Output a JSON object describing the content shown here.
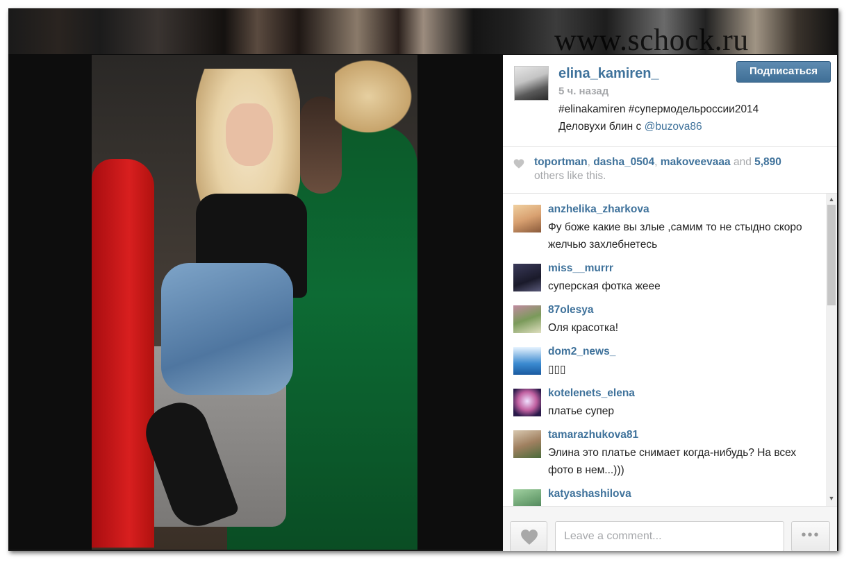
{
  "background": {
    "watermark": "www.schock.ru"
  },
  "post": {
    "username": "elina_kamiren_",
    "time": "5 ч. назад",
    "follow_label": "Подписаться",
    "caption_line1": "#elinakamiren #супермодельроссии2014 ",
    "caption_line2_prefix": "Деловухи блин с ",
    "caption_mention": "@buzova86"
  },
  "likes": {
    "user1": "toportman",
    "sep1": ", ",
    "user2": "dasha_0504",
    "sep2": ", ",
    "user3": "makoveevaaa",
    "and": " and ",
    "count": "5,890",
    "suffix": "others like this."
  },
  "comments": [
    {
      "user": "anzhelika_zharkova",
      "text": "Фу боже какие вы злые ,самим то не стыдно скоро желчью захлебнетесь",
      "avatar_color": "#d8a070"
    },
    {
      "user": "miss__murrr",
      "text": "суперская фотка жеее",
      "avatar_color": "#2a2a3a"
    },
    {
      "user": "87olesya",
      "text": "Оля красотка!",
      "avatar_color": "#7a9a5a"
    },
    {
      "user": "dom2_news_",
      "text": "",
      "avatar_color": "#3a8ad0"
    },
    {
      "user": "kotelenets_elena",
      "text": "платье супер",
      "avatar_color": "#c060a0"
    },
    {
      "user": "tamarazhukova81",
      "text": "Элина это платье снимает когда-нибудь? На всех фото в нем...)))",
      "avatar_color": "#a08060"
    },
    {
      "user": "katyashashilova",
      "text": "",
      "avatar_color": "#6aa070"
    }
  ],
  "footer": {
    "comment_placeholder": "Leave a comment...",
    "more_label": "•••"
  },
  "colors": {
    "link": "#3f729b",
    "muted": "#a5a7aa",
    "follow": "#4a7aa3"
  }
}
